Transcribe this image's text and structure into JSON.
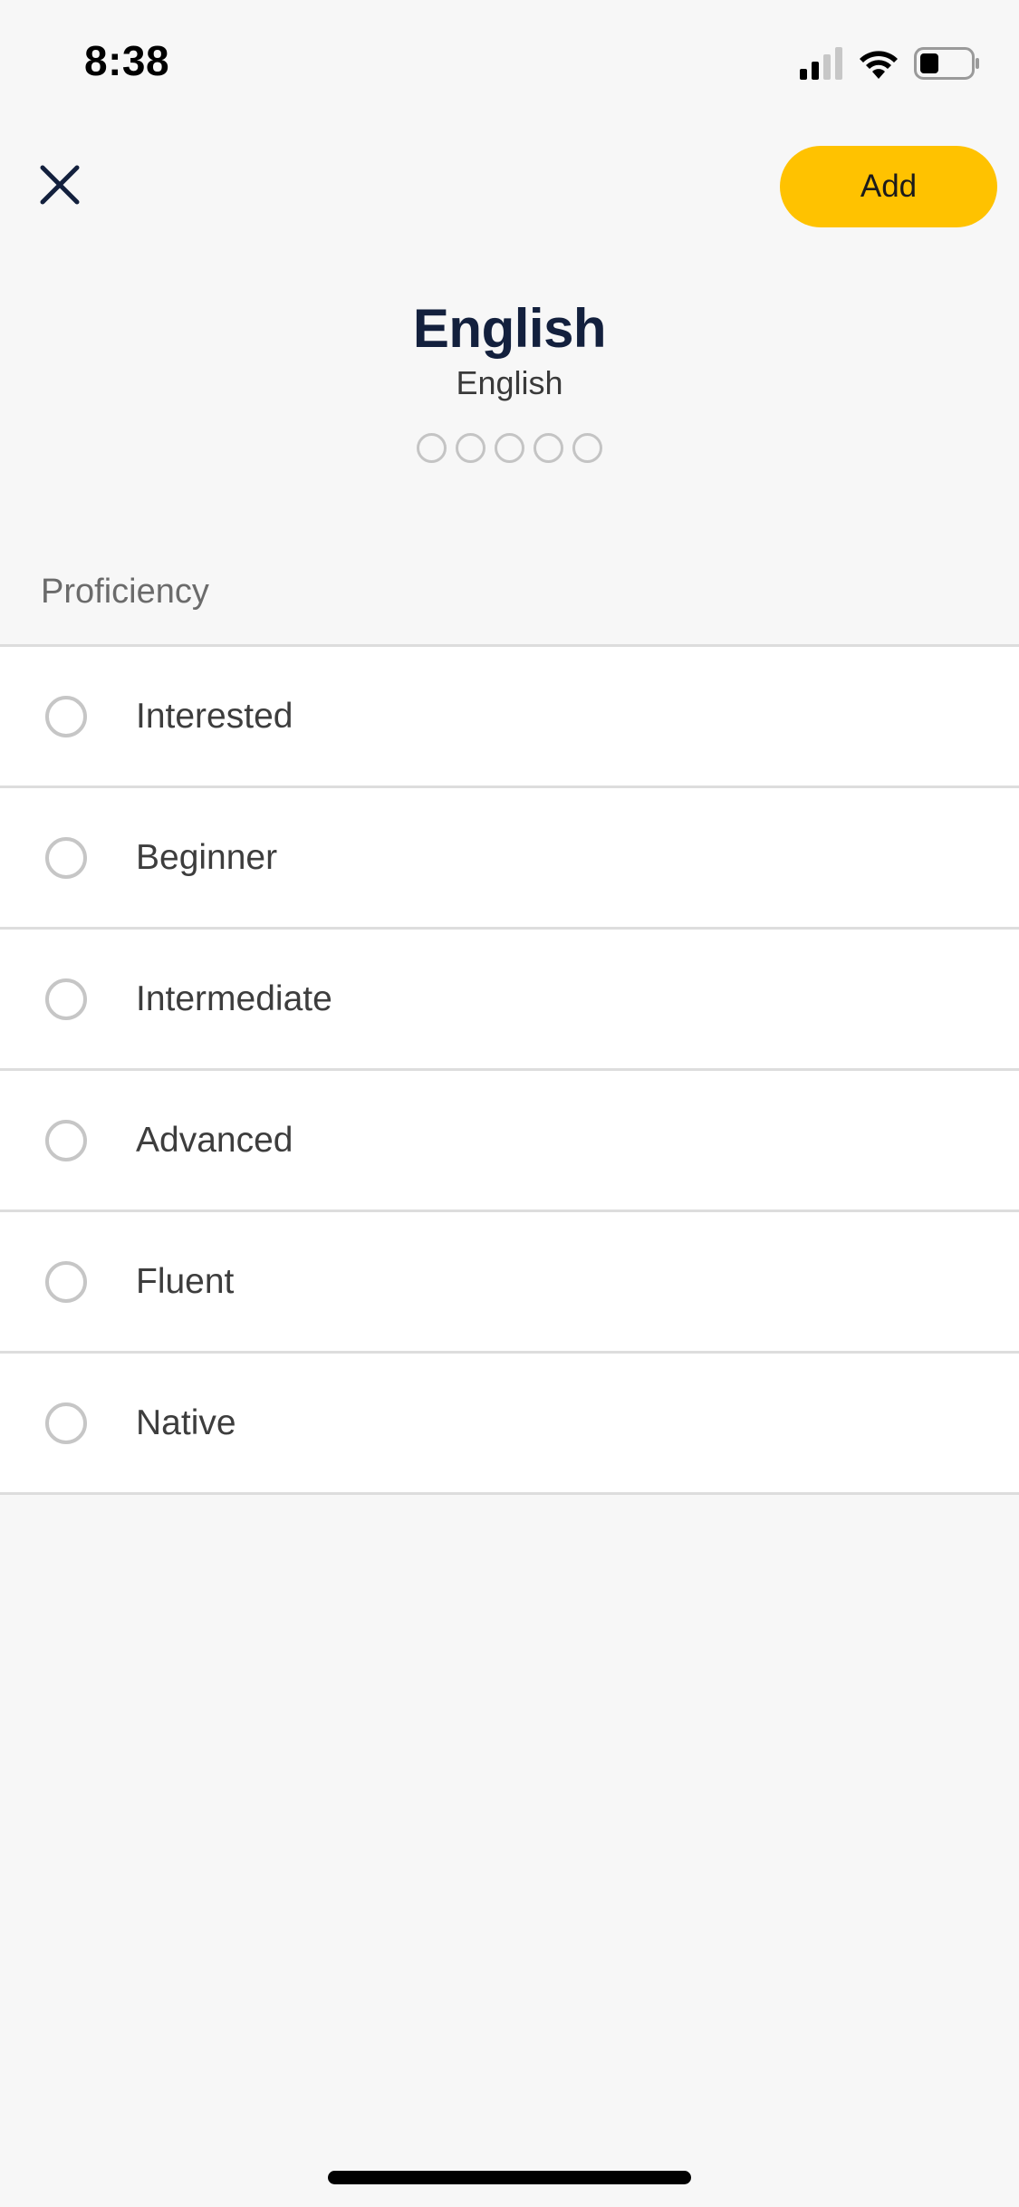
{
  "status_bar": {
    "time": "8:38",
    "icons": [
      "cellular-signal-icon",
      "wifi-icon",
      "battery-icon"
    ]
  },
  "header": {
    "close_icon": "close-icon",
    "add_label": "Add"
  },
  "language": {
    "name": "English",
    "native_name": "English",
    "proficiency_level": 0,
    "proficiency_max": 5
  },
  "proficiency": {
    "section_label": "Proficiency",
    "options": [
      {
        "label": "Interested",
        "selected": false
      },
      {
        "label": "Beginner",
        "selected": false
      },
      {
        "label": "Intermediate",
        "selected": false
      },
      {
        "label": "Advanced",
        "selected": false
      },
      {
        "label": "Fluent",
        "selected": false
      },
      {
        "label": "Native",
        "selected": false
      }
    ]
  },
  "colors": {
    "accent": "#ffc200",
    "title": "#13203d",
    "background": "#f7f7f7"
  }
}
